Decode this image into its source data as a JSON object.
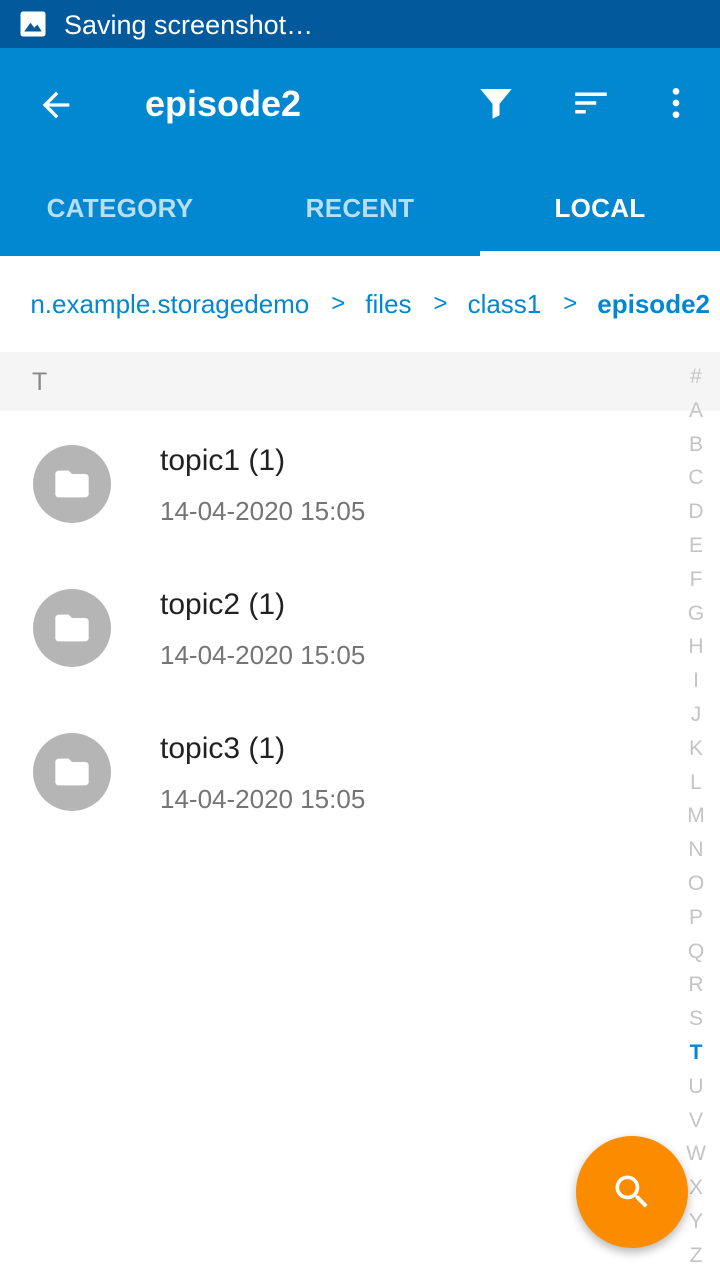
{
  "status_bar": {
    "icon": "image-icon",
    "text": "Saving screenshot…"
  },
  "toolbar": {
    "back_icon": "arrow-back-icon",
    "title": "episode2",
    "filter_icon": "filter-icon",
    "sort_icon": "sort-icon",
    "more_icon": "more-vert-icon"
  },
  "tabs": [
    {
      "label": "CATEGORY",
      "active": false
    },
    {
      "label": "RECENT",
      "active": false
    },
    {
      "label": "LOCAL",
      "active": true
    }
  ],
  "breadcrumb": {
    "items": [
      "n.example.storagedemo",
      "files",
      "class1",
      "episode2"
    ],
    "separator": ">"
  },
  "section_header": "T",
  "files": [
    {
      "name": "topic1 (1)",
      "date": "14-04-2020 15:05",
      "icon": "folder-icon"
    },
    {
      "name": "topic2 (1)",
      "date": "14-04-2020 15:05",
      "icon": "folder-icon"
    },
    {
      "name": "topic3 (1)",
      "date": "14-04-2020 15:05",
      "icon": "folder-icon"
    }
  ],
  "alpha_index": [
    "#",
    "A",
    "B",
    "C",
    "D",
    "E",
    "F",
    "G",
    "H",
    "I",
    "J",
    "K",
    "L",
    "M",
    "N",
    "O",
    "P",
    "Q",
    "R",
    "S",
    "T",
    "U",
    "V",
    "W",
    "X",
    "Y",
    "Z"
  ],
  "alpha_index_active": "T",
  "fab": {
    "icon": "search-icon"
  },
  "colors": {
    "status_bar": "#02599c",
    "app_bar": "#0288d1",
    "accent": "#0288d1",
    "fab": "#fb8c00",
    "folder_avatar": "#b5b5b5"
  }
}
